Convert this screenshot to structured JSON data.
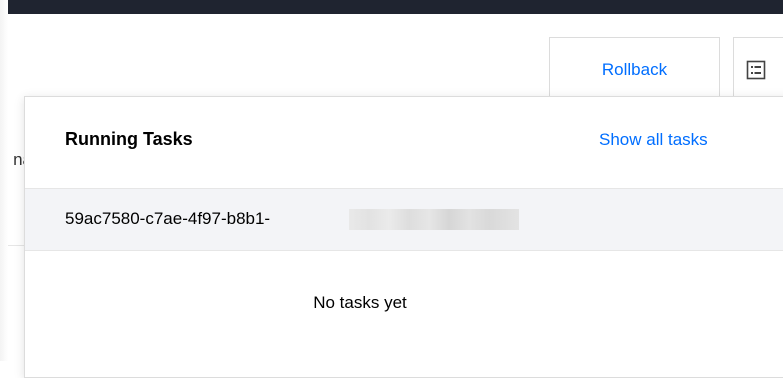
{
  "toolbar": {
    "rollback_label": "Rollback",
    "list_icon": "list-icon"
  },
  "background": {
    "peek_text": "na"
  },
  "popover": {
    "title": "Running Tasks",
    "show_all_label": "Show all tasks",
    "tasks": [
      {
        "id": "59ac7580-c7ae-4f97-b8b1-"
      }
    ],
    "empty_text": "No tasks yet"
  },
  "colors": {
    "accent": "#006eff",
    "top_bar": "#1f2430",
    "row_highlight": "#f3f4f7",
    "border": "#dcdcdc"
  }
}
